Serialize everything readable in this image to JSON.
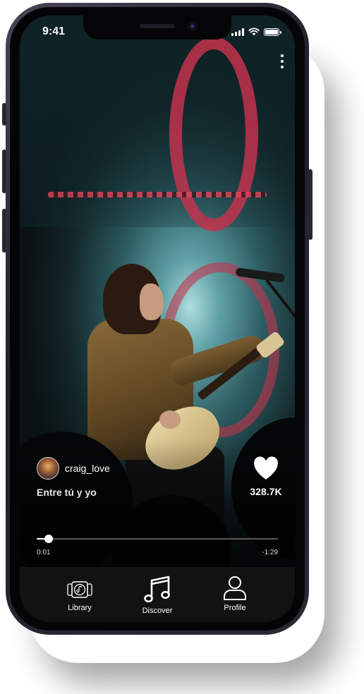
{
  "status_bar": {
    "time": "9:41"
  },
  "player": {
    "artist_name": "craig_love",
    "song_title": "Entre tú y yo",
    "like_count": "328.7K",
    "progress_fraction": 0.05,
    "elapsed": "0:01",
    "remaining": "-1:29"
  },
  "tabs": [
    {
      "label": "Library",
      "icon": "album-icon",
      "active": false
    },
    {
      "label": "Discover",
      "icon": "music-note-icon",
      "active": true
    },
    {
      "label": "Profile",
      "icon": "person-icon",
      "active": false
    }
  ],
  "colors": {
    "accent": "#ffffff",
    "tabbar": "#121212",
    "stage_red": "#c2334d"
  }
}
